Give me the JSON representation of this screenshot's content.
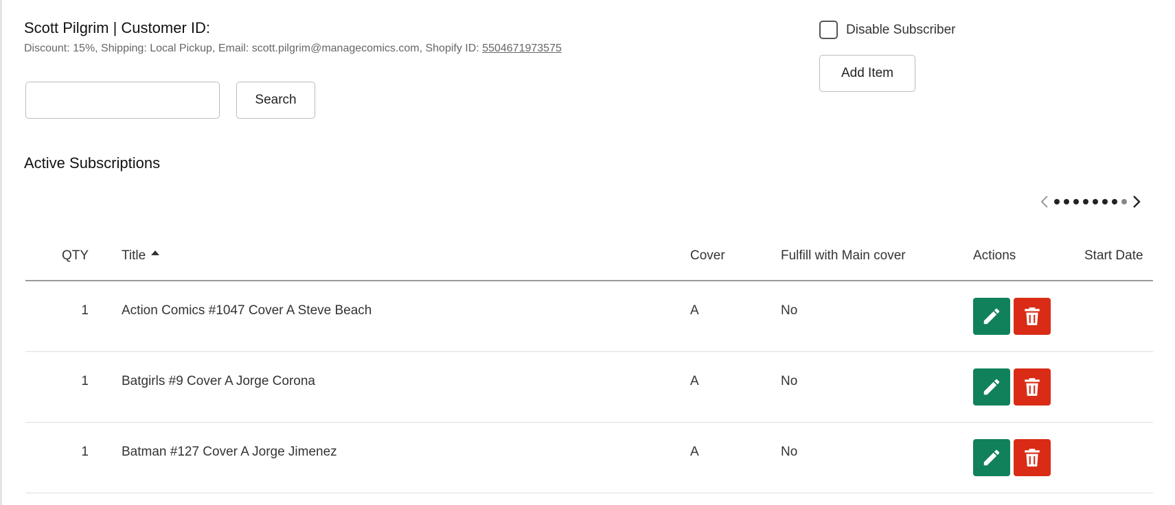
{
  "customer": {
    "name_line": "Scott Pilgrim | Customer ID:",
    "meta_prefix": "Discount: 15%, Shipping: Local Pickup, Email: scott.pilgrim@managecomics.com, Shopify ID: ",
    "shopify_id": "5504671973575"
  },
  "controls": {
    "disable_label": "Disable Subscriber",
    "disable_checked": false,
    "add_item_label": "Add Item",
    "search_label": "Search",
    "search_value": "",
    "search_placeholder": ""
  },
  "section_title": "Active Subscriptions",
  "pager": {
    "dot_count": 8,
    "active_dot_index": 7
  },
  "table": {
    "headers": {
      "qty": "QTY",
      "title": "Title",
      "cover": "Cover",
      "fulfill": "Fulfill with Main cover",
      "actions": "Actions",
      "start": "Start Date"
    },
    "sort": {
      "column": "title",
      "direction": "ascending"
    },
    "rows": [
      {
        "qty": "1",
        "title": "Action Comics #1047 Cover A Steve Beach",
        "cover": "A",
        "fulfill": "No",
        "start": ""
      },
      {
        "qty": "1",
        "title": "Batgirls #9 Cover A Jorge Corona",
        "cover": "A",
        "fulfill": "No",
        "start": ""
      },
      {
        "qty": "1",
        "title": "Batman #127 Cover A Jorge Jimenez",
        "cover": "A",
        "fulfill": "No",
        "start": ""
      }
    ]
  },
  "icons": {
    "edit": "pencil-icon",
    "delete": "trash-icon",
    "prev": "chevron-left-icon",
    "next": "chevron-right-icon"
  },
  "colors": {
    "edit": "#10815a",
    "delete": "#d92b16"
  }
}
